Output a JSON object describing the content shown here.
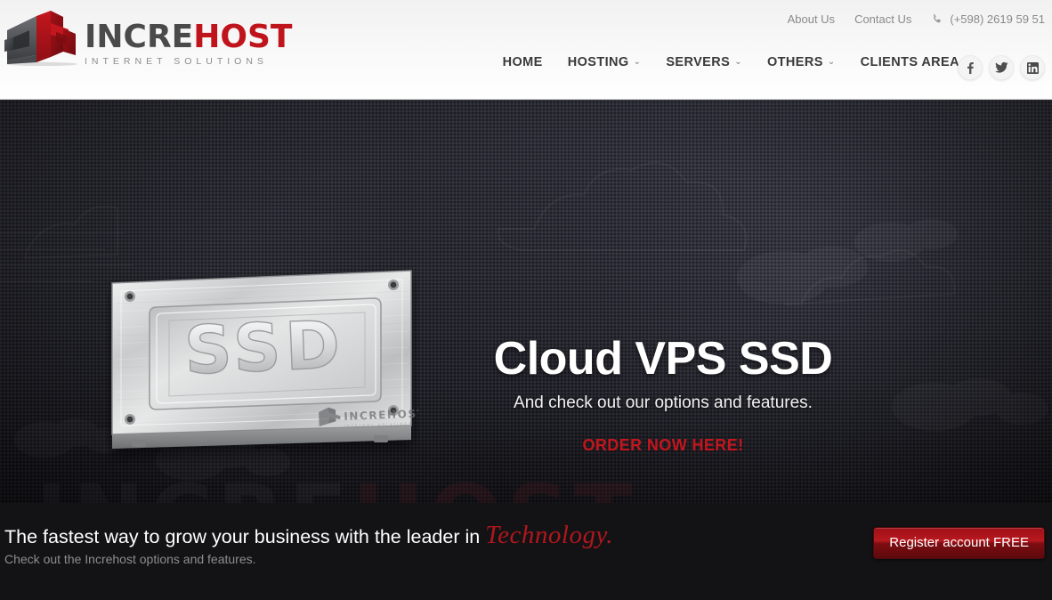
{
  "brand": {
    "logo_primary": "INCRE",
    "logo_accent": "HOST",
    "logo_tagline": "INTERNET SOLUTIONS",
    "accent_color": "#c0141c",
    "dark_color": "#4a4a4a"
  },
  "header": {
    "utility": {
      "about": "About Us",
      "contact": "Contact Us",
      "phone": "(+598) 2619 59 51",
      "phone_icon": "phone-icon"
    },
    "nav": [
      {
        "label": "HOME",
        "has_dropdown": false
      },
      {
        "label": "HOSTING",
        "has_dropdown": true,
        "caret": "⌄"
      },
      {
        "label": "SERVERS",
        "has_dropdown": true,
        "caret": "⌄"
      },
      {
        "label": "OTHERS",
        "has_dropdown": true,
        "caret": "⌄"
      },
      {
        "label": "CLIENTS AREA",
        "has_dropdown": false
      }
    ],
    "social": [
      {
        "name": "facebook-icon",
        "glyph": "f"
      },
      {
        "name": "twitter-icon",
        "glyph": "twitter"
      },
      {
        "name": "linkedin-icon",
        "glyph": "in"
      }
    ]
  },
  "hero": {
    "title": "Cloud VPS SSD",
    "subtitle": "And check out our options and features.",
    "cta": "ORDER NOW HERE!",
    "cta_color": "#c2161d",
    "product_label": "SSD",
    "product_brand": "INCREHOST",
    "product_brand_sub": "internet solutions",
    "watermark_primary": "INCRE",
    "watermark_accent": "HOST",
    "slides": [
      {
        "index": 1,
        "active": true
      },
      {
        "index": 2,
        "active": false
      },
      {
        "index": 3,
        "active": false
      },
      {
        "index": 4,
        "active": false
      }
    ]
  },
  "bottom_bar": {
    "headline_lead": "The fastest way to grow your business with the leader in",
    "headline_emphasis": "Technology.",
    "subline": "Check out the Increhost options and features.",
    "register_button": "Register account FREE",
    "register_color": "#b8191f"
  }
}
